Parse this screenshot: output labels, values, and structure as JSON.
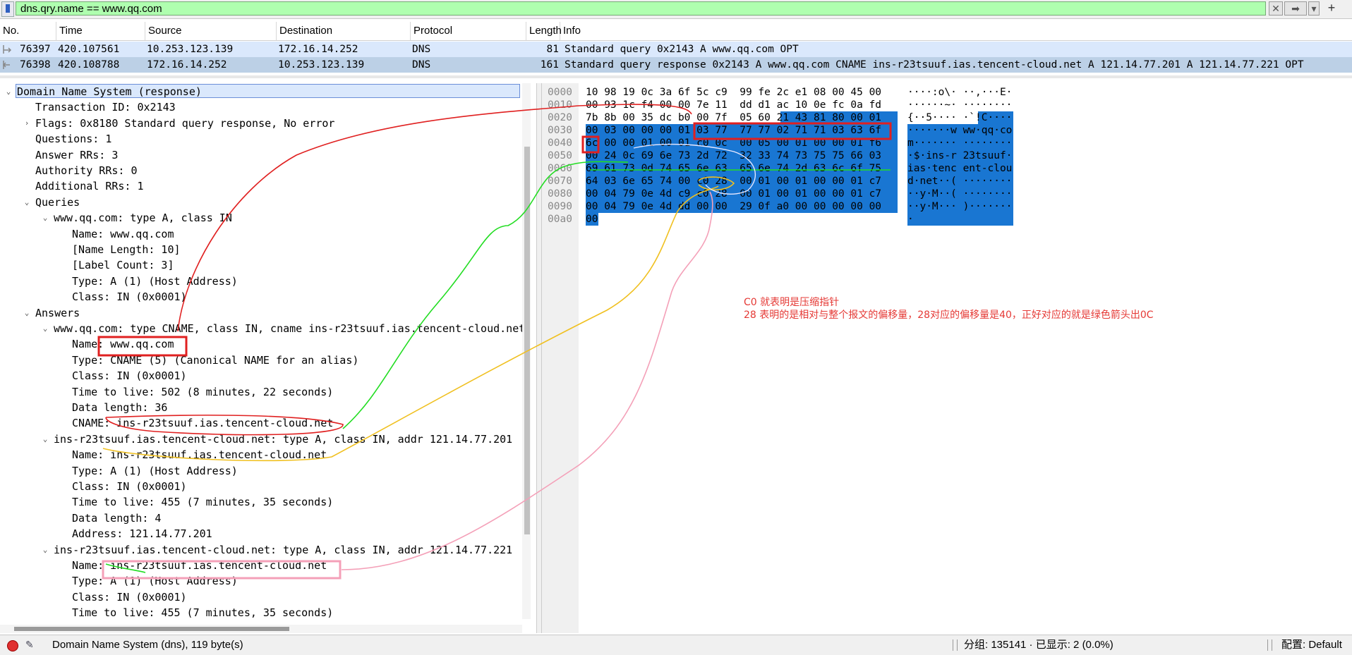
{
  "filter": {
    "value": "dns.qry.name == www.qq.com"
  },
  "packet_list": {
    "columns": [
      "No.",
      "Time",
      "Source",
      "Destination",
      "Protocol",
      "Length",
      "Info"
    ],
    "rows": [
      {
        "no": "76397",
        "time": "420.107561",
        "source": "10.253.123.139",
        "destination": "172.16.14.252",
        "protocol": "DNS",
        "length": "81",
        "info": "Standard query 0x2143 A www.qq.com OPT"
      },
      {
        "no": "76398",
        "time": "420.108788",
        "source": "172.16.14.252",
        "destination": "10.253.123.139",
        "protocol": "DNS",
        "length": "161",
        "info": "Standard query response 0x2143 A www.qq.com CNAME ins-r23tsuuf.ias.tencent-cloud.net A 121.14.77.201 A 121.14.77.221 OPT"
      }
    ]
  },
  "details": [
    {
      "text": "Domain Name System (response)",
      "level": 0,
      "arrow": "down"
    },
    {
      "text": "Transaction ID: 0x2143",
      "level": 1,
      "arrow": ""
    },
    {
      "text": "Flags: 0x8180 Standard query response, No error",
      "level": 1,
      "arrow": "right"
    },
    {
      "text": "Questions: 1",
      "level": 1,
      "arrow": ""
    },
    {
      "text": "Answer RRs: 3",
      "level": 1,
      "arrow": ""
    },
    {
      "text": "Authority RRs: 0",
      "level": 1,
      "arrow": ""
    },
    {
      "text": "Additional RRs: 1",
      "level": 1,
      "arrow": ""
    },
    {
      "text": "Queries",
      "level": 1,
      "arrow": "down"
    },
    {
      "text": "www.qq.com: type A, class IN",
      "level": 2,
      "arrow": "down"
    },
    {
      "text": "Name: www.qq.com",
      "level": 3,
      "arrow": ""
    },
    {
      "text": "[Name Length: 10]",
      "level": 3,
      "arrow": ""
    },
    {
      "text": "[Label Count: 3]",
      "level": 3,
      "arrow": ""
    },
    {
      "text": "Type: A (1) (Host Address)",
      "level": 3,
      "arrow": ""
    },
    {
      "text": "Class: IN (0x0001)",
      "level": 3,
      "arrow": ""
    },
    {
      "text": "Answers",
      "level": 1,
      "arrow": "down"
    },
    {
      "text": "www.qq.com: type CNAME, class IN, cname ins-r23tsuuf.ias.tencent-cloud.net",
      "level": 2,
      "arrow": "down"
    },
    {
      "text": "Name: www.qq.com",
      "level": 3,
      "arrow": ""
    },
    {
      "text": "Type: CNAME (5) (Canonical NAME for an alias)",
      "level": 3,
      "arrow": ""
    },
    {
      "text": "Class: IN (0x0001)",
      "level": 3,
      "arrow": ""
    },
    {
      "text": "Time to live: 502 (8 minutes, 22 seconds)",
      "level": 3,
      "arrow": ""
    },
    {
      "text": "Data length: 36",
      "level": 3,
      "arrow": ""
    },
    {
      "text": "CNAME: ins-r23tsuuf.ias.tencent-cloud.net",
      "level": 3,
      "arrow": ""
    },
    {
      "text": "ins-r23tsuuf.ias.tencent-cloud.net: type A, class IN, addr 121.14.77.201",
      "level": 2,
      "arrow": "down"
    },
    {
      "text": "Name: ins-r23tsuuf.ias.tencent-cloud.net",
      "level": 3,
      "arrow": ""
    },
    {
      "text": "Type: A (1) (Host Address)",
      "level": 3,
      "arrow": ""
    },
    {
      "text": "Class: IN (0x0001)",
      "level": 3,
      "arrow": ""
    },
    {
      "text": "Time to live: 455 (7 minutes, 35 seconds)",
      "level": 3,
      "arrow": ""
    },
    {
      "text": "Data length: 4",
      "level": 3,
      "arrow": ""
    },
    {
      "text": "Address: 121.14.77.201",
      "level": 3,
      "arrow": ""
    },
    {
      "text": "ins-r23tsuuf.ias.tencent-cloud.net: type A, class IN, addr 121.14.77.221",
      "level": 2,
      "arrow": "down"
    },
    {
      "text": "Name: ins-r23tsuuf.ias.tencent-cloud.net",
      "level": 3,
      "arrow": ""
    },
    {
      "text": "Type: A (1) (Host Address)",
      "level": 3,
      "arrow": ""
    },
    {
      "text": "Class: IN (0x0001)",
      "level": 3,
      "arrow": ""
    },
    {
      "text": "Time to live: 455 (7 minutes, 35 seconds)",
      "level": 3,
      "arrow": ""
    }
  ],
  "bytes": [
    {
      "offset": "0000",
      "hex": "10 98 19 0c 3a 6f 5c c9  99 fe 2c e1 08 00 45 00",
      "ascii": "····:o\\· ··,···E·"
    },
    {
      "offset": "0010",
      "hex": "00 93 1c f4 00 00 7e 11  dd d1 ac 10 0e fc 0a fd",
      "ascii": "······~· ········"
    },
    {
      "offset": "0020",
      "hex": "7b 8b 00 35 dc b0 00 7f  05 60 21 43 81 80 00 01",
      "ascii": "{··5···· ·`!C····"
    },
    {
      "offset": "0030",
      "hex": "00 03 00 00 00 01 03 77  77 77 02 71 71 03 63 6f",
      "ascii": "·······w ww·qq·co"
    },
    {
      "offset": "0040",
      "hex": "6c 00 00 01 00 01 c0 0c  00 05 00 01 00 00 01 f6",
      "ascii": "m······· ········"
    },
    {
      "offset": "0050",
      "hex": "00 24 0c 69 6e 73 2d 72  32 33 74 73 75 75 66 03",
      "ascii": "·$·ins-r 23tsuuf·"
    },
    {
      "offset": "0060",
      "hex": "69 61 73 0d 74 65 6e 63  65 6e 74 2d 63 6c 6f 75",
      "ascii": "ias·tenc ent-clou"
    },
    {
      "offset": "0070",
      "hex": "64 03 6e 65 74 00 c0 28  00 01 00 01 00 00 01 c7",
      "ascii": "d·net··( ········"
    },
    {
      "offset": "0080",
      "hex": "00 04 79 0e 4d c9 c0 28  00 01 00 01 00 00 01 c7",
      "ascii": "··y·M··( ········"
    },
    {
      "offset": "0090",
      "hex": "00 04 79 0e 4d dd 00 00  29 0f a0 00 00 00 00 00",
      "ascii": "··y·M··· )·······"
    },
    {
      "offset": "00a0",
      "hex": "00",
      "ascii": "·"
    }
  ],
  "annotation": {
    "line1": "C0 就表明是压缩指针",
    "line2": "28 表明的是相对与整个报文的偏移量，28对应的偏移量是40，正好对应的就是绿色箭头出0C"
  },
  "status": {
    "left": "Domain Name System (dns), 119 byte(s)",
    "packets": "分组: 135141 · 已显示: 2 (0.0%)",
    "profile": "配置: Default"
  },
  "colors": {
    "filter_bg": "#afffaf",
    "selected_row": "#bcd0e6",
    "byte_highlight": "#1976d2",
    "annotation_red": "#e53935"
  }
}
